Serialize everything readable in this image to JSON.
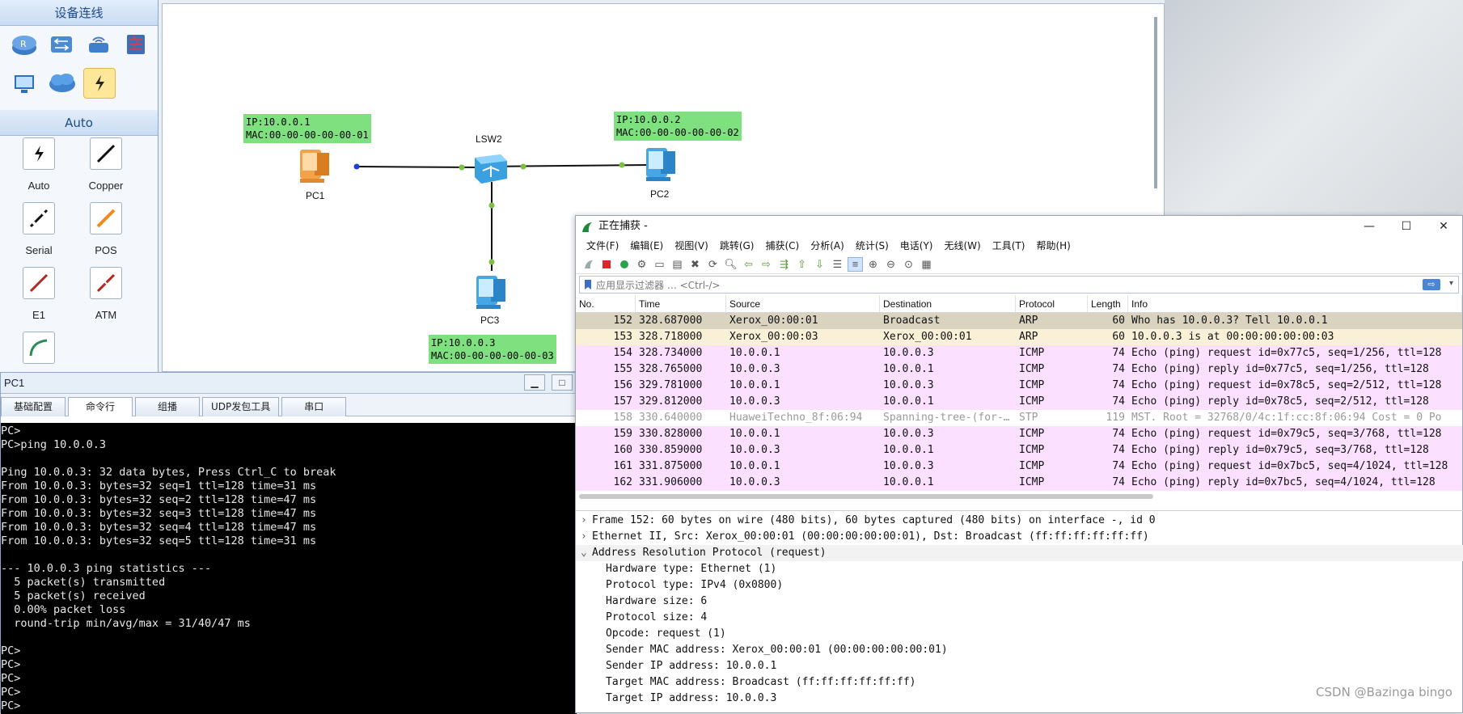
{
  "palette": {
    "section1_title": "设备连线",
    "section2_title": "Auto",
    "device_icons": [
      "router-icon",
      "switch-icon",
      "wireless-icon",
      "firewall-icon",
      "pc-icon",
      "cloud-icon",
      "connection-icon"
    ],
    "cables": [
      {
        "label": "Auto"
      },
      {
        "label": "Copper"
      },
      {
        "label": "Serial"
      },
      {
        "label": "POS"
      },
      {
        "label": "E1"
      },
      {
        "label": "ATM"
      },
      {
        "label": ""
      }
    ]
  },
  "topology": {
    "devices": [
      {
        "name": "PC1",
        "ip": "IP:10.0.0.1",
        "mac": "MAC:00-00-00-00-00-01"
      },
      {
        "name": "PC2",
        "ip": "IP:10.0.0.2",
        "mac": "MAC:00-00-00-00-00-02"
      },
      {
        "name": "PC3",
        "ip": "IP:10.0.0.3",
        "mac": "MAC:00-00-00-00-00-03"
      },
      {
        "name": "LSW2"
      }
    ]
  },
  "pc1_window": {
    "title": "PC1",
    "minimize": "▁",
    "maximize": "□",
    "tabs": [
      "基础配置",
      "命令行",
      "组播",
      "UDP发包工具",
      "串口"
    ],
    "active_tab": "命令行",
    "console_lines": [
      "PC>",
      "PC>ping 10.0.0.3",
      "",
      "Ping 10.0.0.3: 32 data bytes, Press Ctrl_C to break",
      "From 10.0.0.3: bytes=32 seq=1 ttl=128 time=31 ms",
      "From 10.0.0.3: bytes=32 seq=2 ttl=128 time=47 ms",
      "From 10.0.0.3: bytes=32 seq=3 ttl=128 time=47 ms",
      "From 10.0.0.3: bytes=32 seq=4 ttl=128 time=47 ms",
      "From 10.0.0.3: bytes=32 seq=5 ttl=128 time=31 ms",
      "",
      "--- 10.0.0.3 ping statistics ---",
      "  5 packet(s) transmitted",
      "  5 packet(s) received",
      "  0.00% packet loss",
      "  round-trip min/avg/max = 31/40/47 ms",
      "",
      "PC>",
      "PC>",
      "PC>",
      "PC>",
      "PC>"
    ]
  },
  "wireshark": {
    "title": "正在捕获 -",
    "window_controls": [
      "—",
      "☐",
      "✕"
    ],
    "menu": [
      "文件(F)",
      "编辑(E)",
      "视图(V)",
      "跳转(G)",
      "捕获(C)",
      "分析(A)",
      "统计(S)",
      "电话(Y)",
      "无线(W)",
      "工具(T)",
      "帮助(H)"
    ],
    "filter_placeholder": "应用显示过滤器 … <Ctrl-/>",
    "columns": [
      "No.",
      "Time",
      "Source",
      "Destination",
      "Protocol",
      "Length",
      "Info"
    ],
    "colors": {
      "arp_selected": "#d9d3c0",
      "arp": "#faf0d7",
      "icmp": "#fce0ff",
      "stp": "#ffffff"
    },
    "packets": [
      {
        "no": "152",
        "time": "328.687000",
        "src": "Xerox_00:00:01",
        "dst": "Broadcast",
        "proto": "ARP",
        "len": "60",
        "info": "Who has 10.0.0.3? Tell 10.0.0.1",
        "kind": "arp_selected"
      },
      {
        "no": "153",
        "time": "328.718000",
        "src": "Xerox_00:00:03",
        "dst": "Xerox_00:00:01",
        "proto": "ARP",
        "len": "60",
        "info": "10.0.0.3 is at 00:00:00:00:00:03",
        "kind": "arp"
      },
      {
        "no": "154",
        "time": "328.734000",
        "src": "10.0.0.1",
        "dst": "10.0.0.3",
        "proto": "ICMP",
        "len": "74",
        "info": "Echo (ping) request  id=0x77c5, seq=1/256, ttl=128",
        "kind": "icmp"
      },
      {
        "no": "155",
        "time": "328.765000",
        "src": "10.0.0.3",
        "dst": "10.0.0.1",
        "proto": "ICMP",
        "len": "74",
        "info": "Echo (ping) reply    id=0x77c5, seq=1/256, ttl=128",
        "kind": "icmp"
      },
      {
        "no": "156",
        "time": "329.781000",
        "src": "10.0.0.1",
        "dst": "10.0.0.3",
        "proto": "ICMP",
        "len": "74",
        "info": "Echo (ping) request  id=0x78c5, seq=2/512, ttl=128",
        "kind": "icmp"
      },
      {
        "no": "157",
        "time": "329.812000",
        "src": "10.0.0.3",
        "dst": "10.0.0.1",
        "proto": "ICMP",
        "len": "74",
        "info": "Echo (ping) reply    id=0x78c5, seq=2/512, ttl=128",
        "kind": "icmp"
      },
      {
        "no": "158",
        "time": "330.640000",
        "src": "HuaweiTechno_8f:06:94",
        "dst": "Spanning-tree-(for-…",
        "proto": "STP",
        "len": "119",
        "info": "MST. Root = 32768/0/4c:1f:cc:8f:06:94  Cost = 0  Po",
        "kind": "stp"
      },
      {
        "no": "159",
        "time": "330.828000",
        "src": "10.0.0.1",
        "dst": "10.0.0.3",
        "proto": "ICMP",
        "len": "74",
        "info": "Echo (ping) request  id=0x79c5, seq=3/768, ttl=128",
        "kind": "icmp"
      },
      {
        "no": "160",
        "time": "330.859000",
        "src": "10.0.0.3",
        "dst": "10.0.0.1",
        "proto": "ICMP",
        "len": "74",
        "info": "Echo (ping) reply    id=0x79c5, seq=3/768, ttl=128",
        "kind": "icmp"
      },
      {
        "no": "161",
        "time": "331.875000",
        "src": "10.0.0.1",
        "dst": "10.0.0.3",
        "proto": "ICMP",
        "len": "74",
        "info": "Echo (ping) request  id=0x7bc5, seq=4/1024, ttl=128",
        "kind": "icmp"
      },
      {
        "no": "162",
        "time": "331.906000",
        "src": "10.0.0.3",
        "dst": "10.0.0.1",
        "proto": "ICMP",
        "len": "74",
        "info": "Echo (ping) reply    id=0x7bc5, seq=4/1024, ttl=128",
        "kind": "icmp"
      }
    ],
    "details": [
      {
        "arrow": ">",
        "text": "Frame 152: 60 bytes on wire (480 bits), 60 bytes captured (480 bits) on interface -, id 0",
        "indent": 0
      },
      {
        "arrow": ">",
        "text": "Ethernet II, Src: Xerox_00:00:01 (00:00:00:00:00:01), Dst: Broadcast (ff:ff:ff:ff:ff:ff)",
        "indent": 0
      },
      {
        "arrow": "v",
        "text": "Address Resolution Protocol (request)",
        "indent": 0
      },
      {
        "arrow": "",
        "text": "Hardware type: Ethernet (1)",
        "indent": 1
      },
      {
        "arrow": "",
        "text": "Protocol type: IPv4 (0x0800)",
        "indent": 1
      },
      {
        "arrow": "",
        "text": "Hardware size: 6",
        "indent": 1
      },
      {
        "arrow": "",
        "text": "Protocol size: 4",
        "indent": 1
      },
      {
        "arrow": "",
        "text": "Opcode: request (1)",
        "indent": 1
      },
      {
        "arrow": "",
        "text": "Sender MAC address: Xerox_00:00:01 (00:00:00:00:00:01)",
        "indent": 1
      },
      {
        "arrow": "",
        "text": "Sender IP address: 10.0.0.1",
        "indent": 1
      },
      {
        "arrow": "",
        "text": "Target MAC address: Broadcast (ff:ff:ff:ff:ff:ff)",
        "indent": 1
      },
      {
        "arrow": "",
        "text": "Target IP address: 10.0.0.3",
        "indent": 1
      }
    ]
  },
  "watermark": "CSDN @Bazinga bingo"
}
